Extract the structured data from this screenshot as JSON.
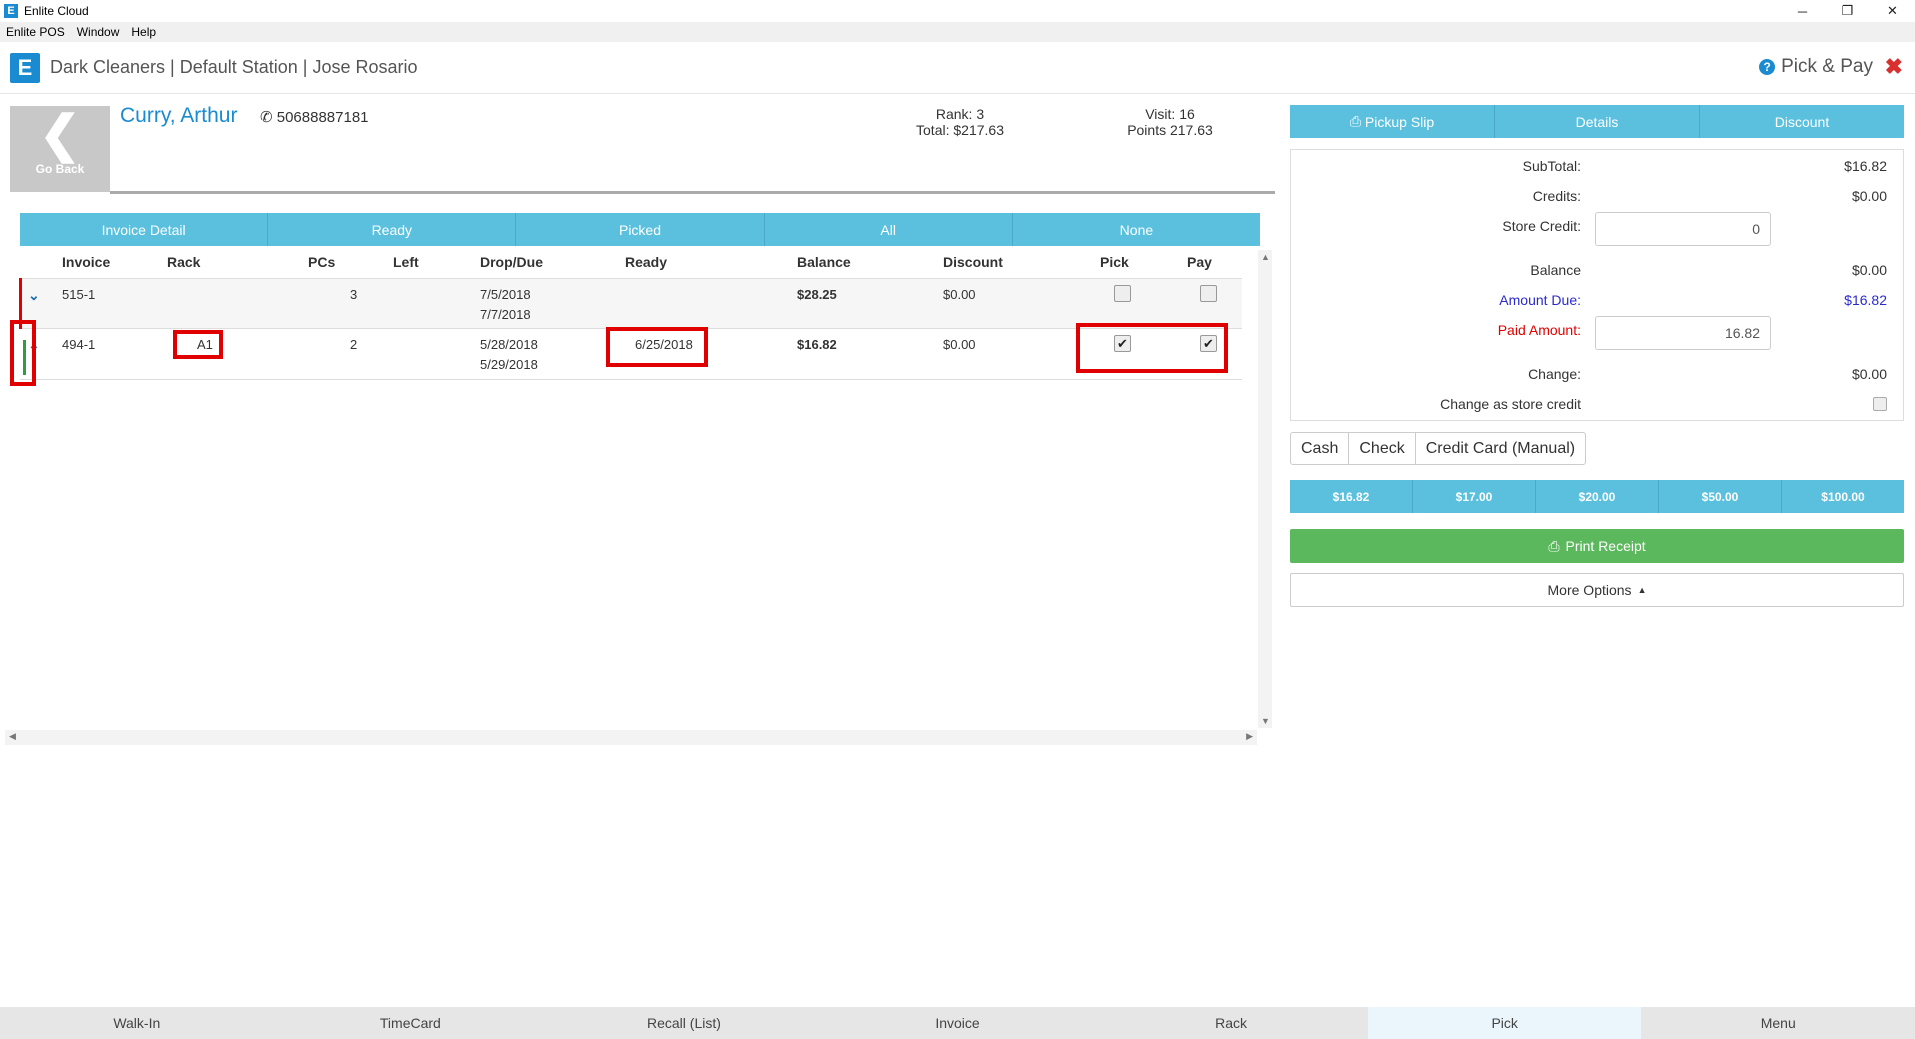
{
  "window": {
    "title": "Enlite Cloud",
    "app_icon_letter": "E",
    "controls": {
      "minimize": "─",
      "restore": "❐",
      "close": "✕"
    }
  },
  "menubar": {
    "items": [
      "Enlite POS",
      "Window",
      "Help"
    ]
  },
  "header": {
    "logo_letter": "E",
    "station": "Dark Cleaners | Default Station | Jose Rosario",
    "page_title": "Pick & Pay",
    "help_glyph": "?",
    "close_glyph": "✖"
  },
  "customer": {
    "go_back_label": "Go Back",
    "name": "Curry, Arthur",
    "phone": "50688887181",
    "rank": "Rank: 3",
    "total": "Total: $217.63",
    "visit": "Visit: 16",
    "points": "Points 217.63"
  },
  "tabs": [
    "Invoice Detail",
    "Ready",
    "Picked",
    "All",
    "None"
  ],
  "table": {
    "headers": [
      "Invoice",
      "Rack",
      "PCs",
      "Left",
      "Drop/Due",
      "Ready",
      "Balance",
      "Discount",
      "Pick",
      "Pay"
    ],
    "rows": [
      {
        "invoice": "515-1",
        "rack": "",
        "pcs": "3",
        "left": "",
        "drop": "7/5/2018",
        "due": "7/7/2018",
        "ready": "",
        "balance": "$28.25",
        "discount": "$0.00",
        "pick": false,
        "pay": false
      },
      {
        "invoice": "494-1",
        "rack": "A1",
        "pcs": "2",
        "left": "",
        "drop": "5/28/2018",
        "due": "5/29/2018",
        "ready": "6/25/2018",
        "balance": "$16.82",
        "discount": "$0.00",
        "pick": true,
        "pay": true
      }
    ]
  },
  "right_panel": {
    "tabs": [
      "Pickup Slip",
      "Details",
      "Discount"
    ],
    "summary": {
      "subtotal_label": "SubTotal:",
      "subtotal": "$16.82",
      "credits_label": "Credits:",
      "credits": "$0.00",
      "store_credit_label": "Store Credit:",
      "store_credit": "0",
      "balance_label": "Balance",
      "balance": "$0.00",
      "amount_due_label": "Amount Due:",
      "amount_due": "$16.82",
      "paid_amount_label": "Paid Amount:",
      "paid_amount": "16.82",
      "change_label": "Change:",
      "change": "$0.00",
      "change_store_credit_label": "Change as store credit"
    },
    "payment_methods": [
      "Cash",
      "Check",
      "Credit Card (Manual)"
    ],
    "quick_amounts": [
      "$16.82",
      "$17.00",
      "$20.00",
      "$50.00",
      "$100.00"
    ],
    "print_receipt_label": "Print Receipt",
    "more_options_label": "More Options"
  },
  "bottom_nav": {
    "items": [
      "Walk-In",
      "TimeCard",
      "Recall (List)",
      "Invoice",
      "Rack",
      "Pick",
      "Menu"
    ],
    "active": "Pick"
  },
  "colors": {
    "accent": "#5bc0de",
    "brand": "#1b8bd1",
    "success": "#5cb85c",
    "danger": "#d9302f",
    "highlight": "#e00000"
  }
}
